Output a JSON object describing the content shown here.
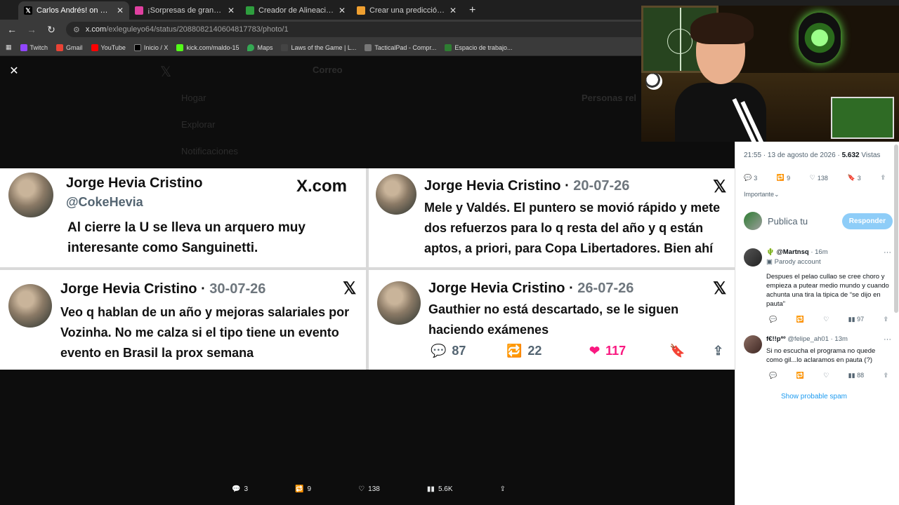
{
  "browser": {
    "tabs": [
      {
        "title": "Carlos Andrés! on X: \"Se cierra el",
        "icon": "x-icon",
        "color": "#000000",
        "active": true
      },
      {
        "title": "¡Sorpresas de gran nivel! Los fic",
        "icon": "pink-icon",
        "color": "#e040a0",
        "active": false
      },
      {
        "title": "Creador de Alineaciones de Fútb",
        "icon": "lineup-icon",
        "color": "#2e9e3e",
        "active": false
      },
      {
        "title": "Crear una predicción Liga de Pri",
        "icon": "doc-icon",
        "color": "#f0a030",
        "active": false
      }
    ],
    "url_host": "x.com",
    "url_path": "/exleguleyo64/status/2088082140604817783/photo/1",
    "bookmarks": [
      "Twitch",
      "Gmail",
      "YouTube",
      "Inicio / X",
      "kick.com/maldo-15",
      "Maps",
      "Laws of the Game | L...",
      "TacticalPad - Compr...",
      "Espacio de trabajo..."
    ]
  },
  "background_page": {
    "header": "Correo",
    "nav": [
      "Hogar",
      "Explorar",
      "Notificaciones"
    ],
    "right_title": "Personas rel"
  },
  "photo": {
    "card1": {
      "name": "Jorge Hevia Cristino",
      "handle": "@CokeHevia",
      "logo": "X.com",
      "text": "Al cierre la U se lleva un arquero muy interesante como Sanguinetti."
    },
    "card2": {
      "name": "Jorge Hevia Cristino",
      "date": "20-07-26",
      "logo": "𝕏",
      "text": "Mele y Valdés. El puntero se movió rápido y mete dos refuerzos para lo q resta del año y q están aptos, a priori, para Copa Libertadores. Bien ahí"
    },
    "card3": {
      "name": "Jorge Hevia Cristino",
      "date": "30-07-26",
      "logo": "𝕏",
      "text": "Veo q hablan de un año y mejoras salariales por Vozinha. No me calza si el tipo tiene un evento evento en Brasil la prox semana"
    },
    "card4": {
      "name": "Jorge Hevia Cristino",
      "date": "26-07-26",
      "logo": "𝕏",
      "text": "Gauthier no está descartado, se le siguen haciendo exámenes",
      "replies": "87",
      "reposts": "22",
      "likes": "117"
    }
  },
  "right_panel": {
    "time": "21:55 · 13 de agosto de 2026 · ",
    "views_count": "5.632",
    "views_label": " Vistas",
    "replies": "3",
    "reposts": "9",
    "likes": "138",
    "bookmarks": "3",
    "importante": "Importante",
    "reply_placeholder": "Publica tu",
    "reply_button": "Responder",
    "comments": [
      {
        "name": "@Martnsq",
        "time": " · 16m",
        "parody": "Parody account",
        "text": "Despues el pelao cullao se cree choro y empieza a putear medio mundo y cuando achunta una tira la tipica de “se dijo en pauta”",
        "views": "97"
      },
      {
        "name": "f€!!pªº",
        "handle": " @felipe_ah01 · 13m",
        "text": "Si no escucha el programa no quede como gil...lo aclaramos en pauta (?)",
        "views": "88"
      }
    ],
    "spam_link": "Show probable spam"
  },
  "bottom_bar": {
    "replies": "3",
    "reposts": "9",
    "likes": "138",
    "views": "5.6K"
  }
}
